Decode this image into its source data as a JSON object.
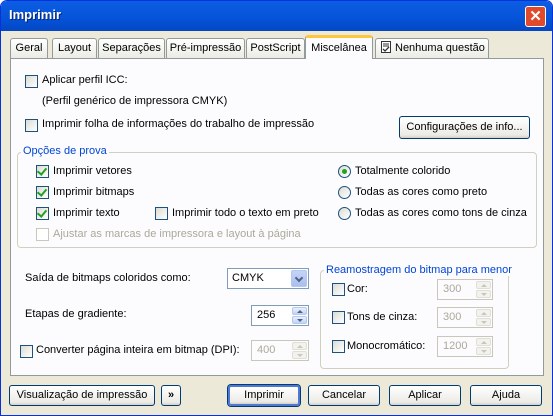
{
  "window": {
    "title": "Imprimir",
    "close_glyph": "✕"
  },
  "tabs": [
    {
      "label": "Geral"
    },
    {
      "label": "Layout"
    },
    {
      "label": "Separações"
    },
    {
      "label": "Pré-impressão"
    },
    {
      "label": "PostScript"
    },
    {
      "label": "Miscelânea",
      "active": true
    },
    {
      "label": "Nenhuma questão",
      "icon": "document-check-icon"
    }
  ],
  "misc": {
    "icc_label": "Aplicar perfil ICC:",
    "icc_profile": "(Perfil genérico de impressora CMYK)",
    "info_sheet_label": "Imprimir folha de informações do trabalho de impressão",
    "info_settings_button": "Configurações de info..."
  },
  "proof": {
    "title": "Opções de prova",
    "print_vectors": "Imprimir vetores",
    "print_bitmaps": "Imprimir bitmaps",
    "print_text": "Imprimir texto",
    "all_text_black": "Imprimir todo o texto em preto",
    "adjust_marks": "Ajustar as marcas de impressora e layout à página",
    "full_color": "Totalmente colorido",
    "all_black": "Todas as cores como preto",
    "all_grayscale": "Todas as cores como tons de cinza"
  },
  "output": {
    "bitmap_output_label": "Saída de bitmaps coloridos como:",
    "bitmap_output_value": "CMYK",
    "gradient_label": "Etapas de gradiente:",
    "gradient_value": "256",
    "convert_label": "Converter página inteira em bitmap (DPI):",
    "convert_value": "400"
  },
  "downsample": {
    "title": "Reamostragem do bitmap para menor",
    "color_label": "Cor:",
    "color_value": "300",
    "gray_label": "Tons de cinza:",
    "gray_value": "300",
    "mono_label": "Monocromático:",
    "mono_value": "1200"
  },
  "footer": {
    "preview_button": "Visualização de impressão",
    "expand_glyph": "»",
    "print_button": "Imprimir",
    "cancel_button": "Cancelar",
    "apply_button": "Aplicar",
    "help_button": "Ajuda"
  },
  "colors": {
    "titlebar": "#0453d8",
    "group_title": "#0046d5",
    "check": "#21a121",
    "active_tab": "#ffc83c"
  }
}
